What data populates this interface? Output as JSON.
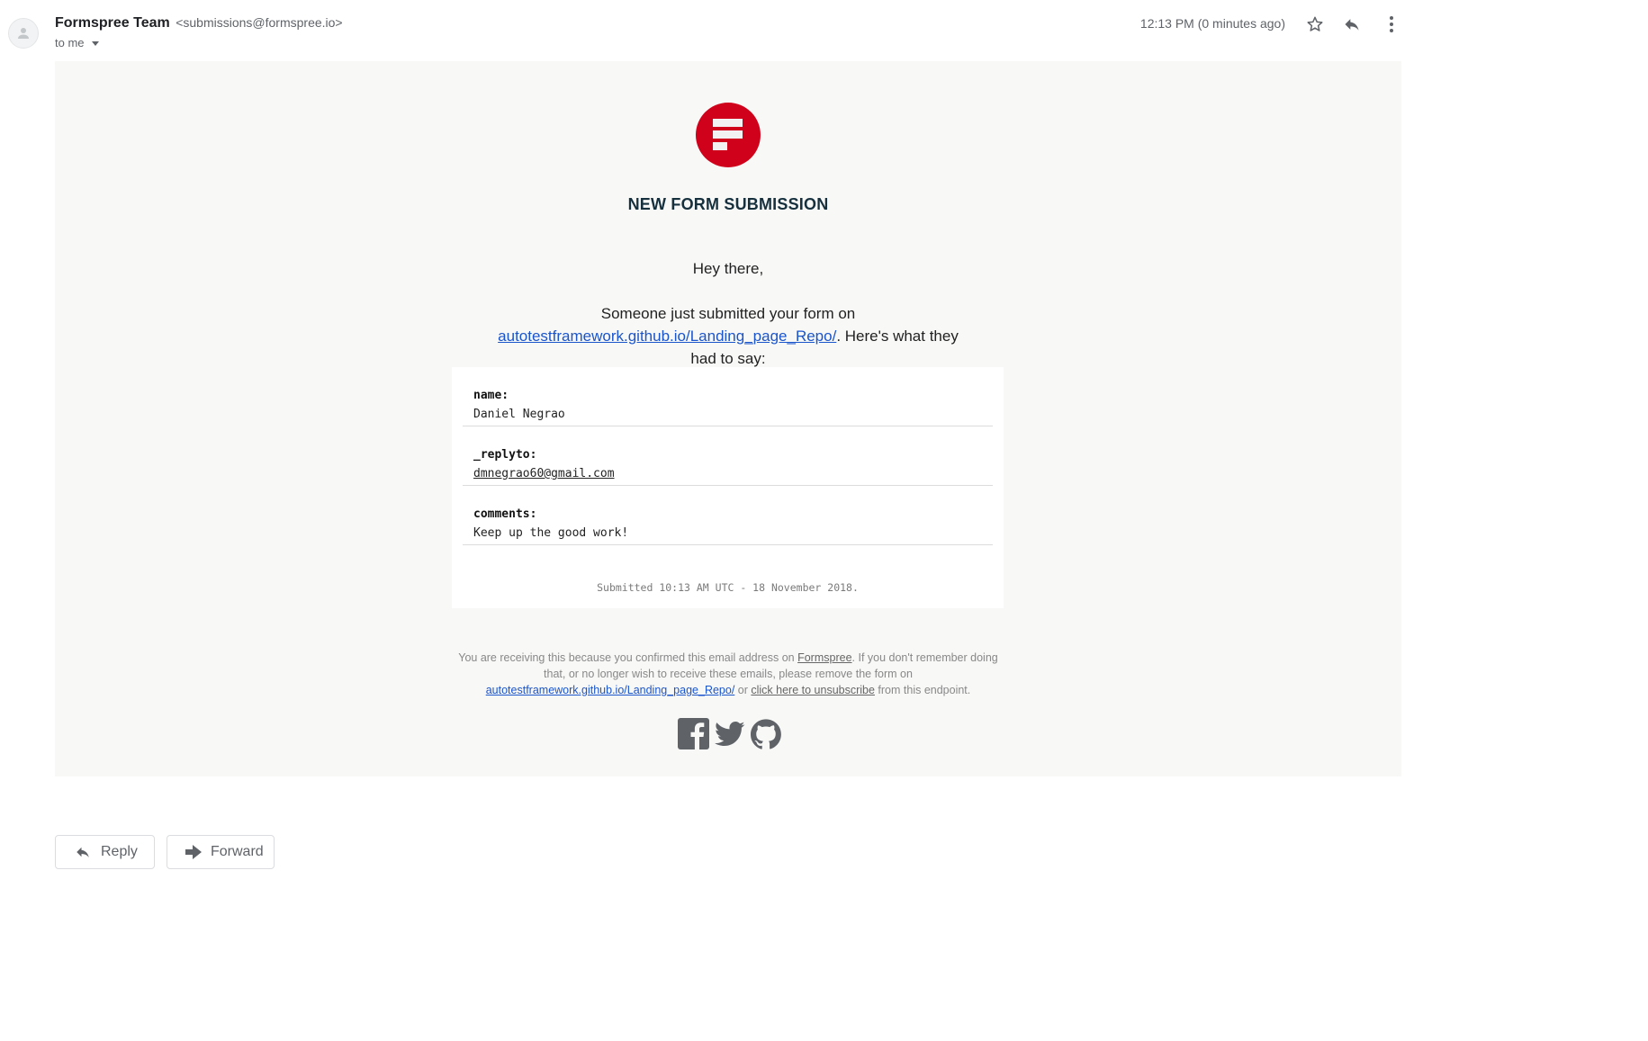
{
  "header": {
    "sender_name": "Formspree Team",
    "sender_email": "<submissions@formspree.io>",
    "recipient": "to me",
    "timestamp": "12:13 PM (0 minutes ago)"
  },
  "email": {
    "headline": "NEW FORM SUBMISSION",
    "greeting": "Hey there,",
    "intro_prefix": "Someone just submitted your form on ",
    "intro_link": "autotestframework.github.io/Landing_page_Repo/",
    "intro_suffix": ". Here's what they had to say:",
    "fields": [
      {
        "key": "name:",
        "value": "Daniel Negrao"
      },
      {
        "key": "_replyto:",
        "value": "dmnegrao60@gmail.com"
      },
      {
        "key": "comments:",
        "value": "Keep up the good work!"
      }
    ],
    "submitted": "Submitted 10:13 AM UTC - 18 November 2018.",
    "footer": {
      "part1": "You are receiving this because you confirmed this email address on ",
      "formspree_link": "Formspree",
      "part2": ". If you don't remember doing that, or no longer wish to receive these emails, please remove the form on ",
      "endpoint_link": "autotestframework.github.io/Landing_page_Repo/",
      "part3": " or ",
      "unsubscribe_link": "click here to unsubscribe",
      "part4": " from this endpoint."
    },
    "social_icons": [
      "facebook-icon",
      "twitter-icon",
      "github-icon"
    ]
  },
  "actions": {
    "reply_label": "Reply",
    "forward_label": "Forward"
  },
  "colors": {
    "brand_red": "#d0021b",
    "link_blue": "#1a55cc",
    "body_bg": "#f8f8f7"
  }
}
